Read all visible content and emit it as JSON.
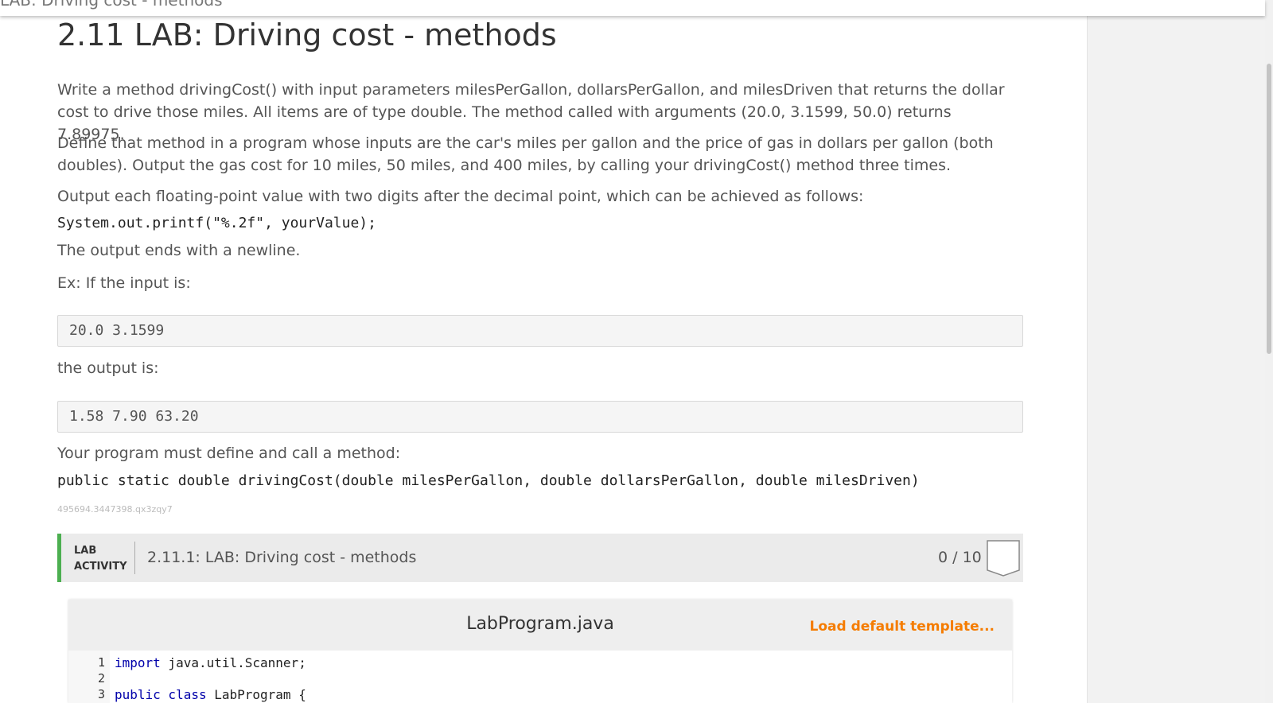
{
  "window": {
    "tab_title": "LAB: Driving cost - methods"
  },
  "page": {
    "title": "2.11 LAB: Driving cost - methods",
    "para1": "Write a method drivingCost() with input parameters milesPerGallon, dollarsPerGallon, and milesDriven that returns the dollar cost to drive those miles. All items are of type double. The method called with arguments (20.0, 3.1599, 50.0) returns 7.89975.",
    "para2": "Define that method in a program whose inputs are the car's miles per gallon and the price of gas in dollars per gallon (both doubles). Output the gas cost for 10 miles, 50 miles, and 400 miles, by calling your drivingCost() method three times.",
    "para3": "Output each floating-point value with two digits after the decimal point, which can be achieved as follows:",
    "printf_code": "System.out.printf(\"%.2f\", yourValue);",
    "para4": "The output ends with a newline.",
    "example_intro": "Ex: If the input is:",
    "example_input": "20.0 3.1599",
    "output_intro": "the output is:",
    "example_output": "1.58 7.90 63.20",
    "method_intro": "Your program must define and call a method:",
    "method_signature": "public static double drivingCost(double milesPerGallon, double dollarsPerGallon, double milesDriven)",
    "identifier": "495694.3447398.qx3zqy7"
  },
  "lab": {
    "tag_line1": "LAB",
    "tag_line2": "ACTIVITY",
    "name": "2.11.1: LAB: Driving cost - methods",
    "score": "0 / 10",
    "accent_color": "#4caf50"
  },
  "editor": {
    "file_name": "LabProgram.java",
    "load_template": "Load default template...",
    "lines": [
      {
        "num": "1",
        "kw": "import",
        "rest": " java.util.Scanner;"
      },
      {
        "num": "2",
        "kw": "",
        "rest": ""
      },
      {
        "num": "3",
        "kw": "public class",
        "rest": " LabProgram {"
      }
    ]
  }
}
